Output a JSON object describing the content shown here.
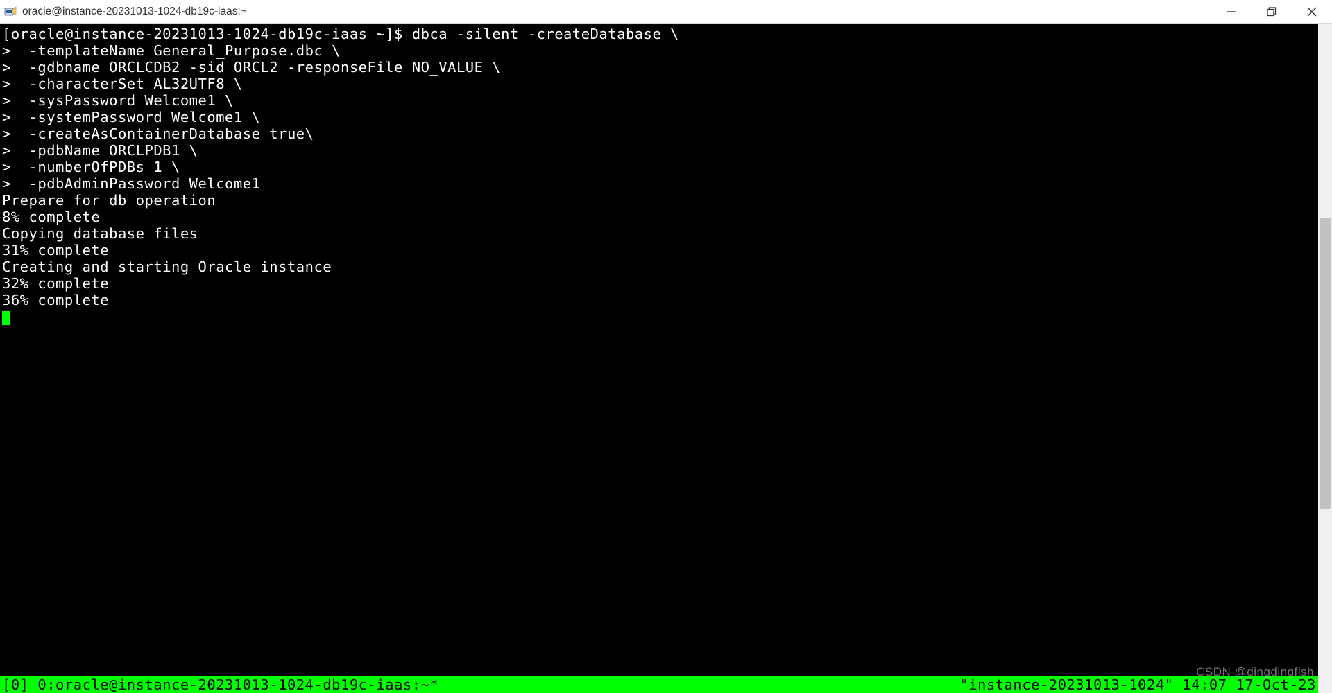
{
  "window": {
    "title": "oracle@instance-20231013-1024-db19c-iaas:~"
  },
  "terminal": {
    "prompt": "[oracle@instance-20231013-1024-db19c-iaas ~]$ ",
    "cmd_main": "dbca -silent -createDatabase \\",
    "cont_prefix": ">  ",
    "lines_cont": [
      "-templateName General_Purpose.dbc \\",
      "-gdbname ORCLCDB2 -sid ORCL2 -responseFile NO_VALUE \\",
      "-characterSet AL32UTF8 \\",
      "-sysPassword Welcome1 \\",
      "-systemPassword Welcome1 \\",
      "-createAsContainerDatabase true\\",
      "-pdbName ORCLPDB1 \\",
      "-numberOfPDBs 1 \\",
      "-pdbAdminPassword Welcome1"
    ],
    "output": [
      "Prepare for db operation",
      "8% complete",
      "Copying database files",
      "31% complete",
      "Creating and starting Oracle instance",
      "32% complete",
      "36% complete"
    ]
  },
  "tmux": {
    "left": "[0] 0:oracle@instance-20231013-1024-db19c-iaas:~*",
    "right": "\"instance-20231013-1024\" 14:07 17-Oct-23"
  },
  "watermark": "CSDN @dingdingfish"
}
